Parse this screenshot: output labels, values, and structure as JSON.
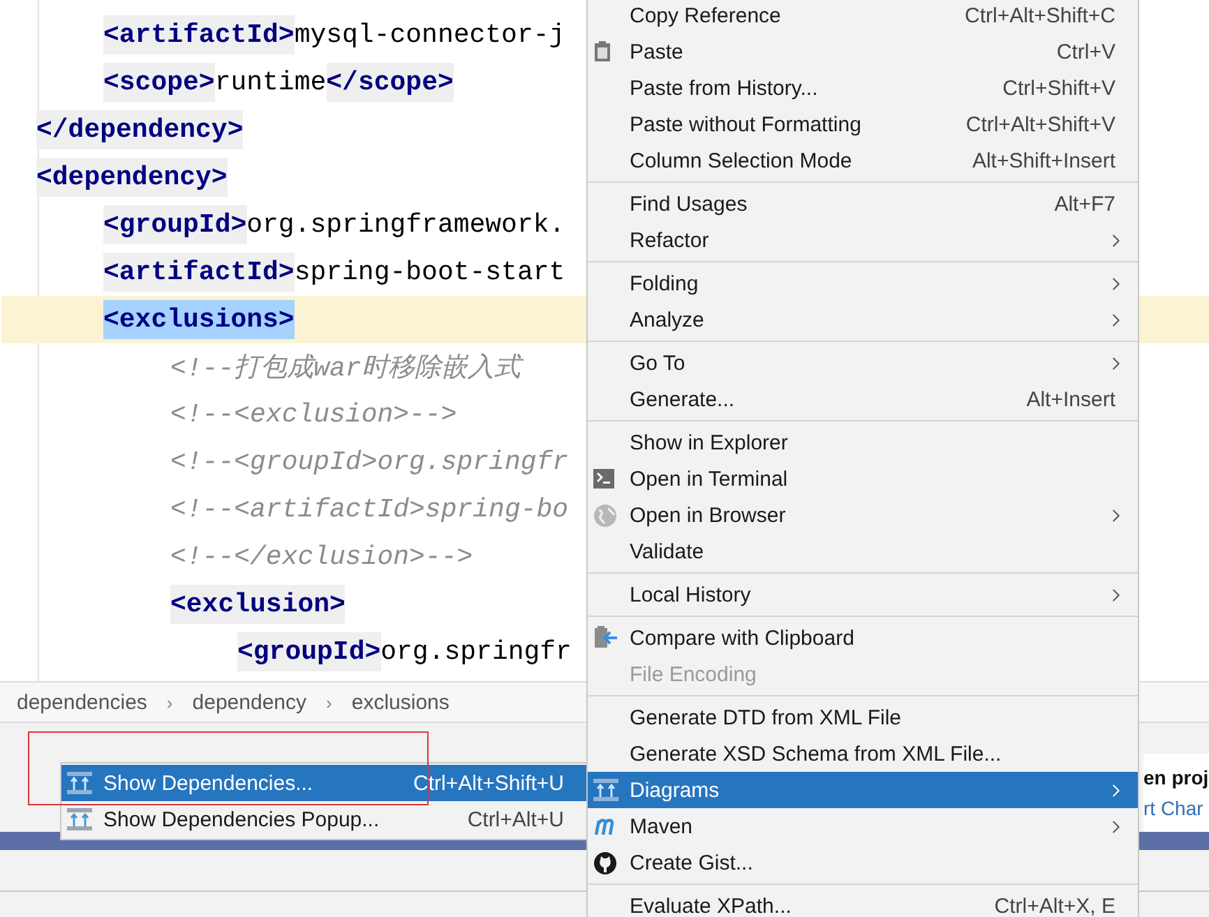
{
  "editor": {
    "lines": [
      {
        "children": [
          {
            "current": false,
            "segments": [
              {
                "kind": "tag",
                "text": "<artifactId>"
              },
              {
                "kind": "text",
                "text": "mysql-connector-j"
              }
            ]
          },
          {
            "current": false,
            "segments": [
              {
                "kind": "tag",
                "text": "<scope>"
              },
              {
                "kind": "text",
                "text": "runtime"
              },
              {
                "kind": "tag",
                "text": "</scope>"
              }
            ]
          }
        ]
      },
      {
        "current": false,
        "segments": [
          {
            "kind": "tag",
            "text": "</dependency>"
          }
        ]
      },
      {
        "current": false,
        "segments": [
          {
            "kind": "tag",
            "text": "<dependency>"
          }
        ],
        "children": [
          {
            "current": false,
            "segments": [
              {
                "kind": "tag",
                "text": "<groupId>"
              },
              {
                "kind": "text",
                "text": "org.springframework."
              }
            ]
          },
          {
            "current": false,
            "segments": [
              {
                "kind": "tag",
                "text": "<artifactId>"
              },
              {
                "kind": "text",
                "text": "spring-boot-start"
              }
            ]
          },
          {
            "current": true,
            "segments": [
              {
                "kind": "selected-tag",
                "text": "<exclusions>"
              }
            ],
            "children": [
              {
                "current": false,
                "segments": [
                  {
                    "kind": "comment",
                    "text": "<!--打包成war时移除嵌入式"
                  }
                ]
              },
              {
                "current": false,
                "segments": [
                  {
                    "kind": "comment",
                    "text": "<!--<exclusion>-->"
                  }
                ]
              },
              {
                "current": false,
                "segments": [
                  {
                    "kind": "comment",
                    "text": "<!--<groupId>org.springfr"
                  }
                ]
              },
              {
                "current": false,
                "segments": [
                  {
                    "kind": "comment",
                    "text": "<!--<artifactId>spring-bo"
                  }
                ]
              },
              {
                "current": false,
                "segments": [
                  {
                    "kind": "comment",
                    "text": "<!--</exclusion>-->"
                  }
                ]
              },
              {
                "current": false,
                "segments": [
                  {
                    "kind": "tag",
                    "text": "<exclusion>"
                  }
                ],
                "children": [
                  {
                    "current": false,
                    "segments": [
                      {
                        "kind": "tag",
                        "text": "<groupId>"
                      },
                      {
                        "kind": "text",
                        "text": "org.springfr"
                      }
                    ]
                  }
                ]
              }
            ]
          }
        ]
      }
    ]
  },
  "breadcrumb": [
    {
      "label": "dependencies",
      "separator": "›"
    },
    {
      "label": "dependency",
      "separator": "›"
    },
    {
      "label": "exclusions"
    }
  ],
  "side_panel": {
    "title": "en proj",
    "link": "rt Char"
  },
  "context_menu": {
    "groups": [
      [
        {
          "label": "Copy Reference",
          "shortcut": "Ctrl+Alt+Shift+C",
          "kind": "plain",
          "submenu": false,
          "disabled": false,
          "selected": false
        },
        {
          "label": "Paste",
          "shortcut": "Ctrl+V",
          "kind": "clipboard",
          "submenu": false,
          "disabled": false,
          "selected": false
        },
        {
          "label": "Paste from History...",
          "shortcut": "Ctrl+Shift+V",
          "kind": "plain",
          "submenu": false,
          "disabled": false,
          "selected": false
        },
        {
          "label": "Paste without Formatting",
          "shortcut": "Ctrl+Alt+Shift+V",
          "kind": "plain",
          "submenu": false,
          "disabled": false,
          "selected": false
        },
        {
          "label": "Column Selection Mode",
          "shortcut": "Alt+Shift+Insert",
          "kind": "plain",
          "submenu": false,
          "disabled": false,
          "selected": false
        }
      ],
      [
        {
          "label": "Find Usages",
          "shortcut": "Alt+F7",
          "kind": "plain",
          "submenu": false,
          "disabled": false,
          "selected": false
        },
        {
          "label": "Refactor",
          "kind": "plain",
          "submenu": true,
          "disabled": false,
          "selected": false
        }
      ],
      [
        {
          "label": "Folding",
          "kind": "plain",
          "submenu": true,
          "disabled": false,
          "selected": false
        },
        {
          "label": "Analyze",
          "kind": "plain",
          "submenu": true,
          "disabled": false,
          "selected": false
        }
      ],
      [
        {
          "label": "Go To",
          "kind": "plain",
          "submenu": true,
          "disabled": false,
          "selected": false
        },
        {
          "label": "Generate...",
          "shortcut": "Alt+Insert",
          "kind": "plain",
          "submenu": false,
          "disabled": false,
          "selected": false
        }
      ],
      [
        {
          "label": "Show in Explorer",
          "kind": "plain",
          "submenu": false,
          "disabled": false,
          "selected": false
        },
        {
          "label": "Open in Terminal",
          "kind": "terminal",
          "submenu": false,
          "disabled": false,
          "selected": false
        },
        {
          "label": "Open in Browser",
          "kind": "globe",
          "submenu": true,
          "disabled": false,
          "selected": false
        },
        {
          "label": "Validate",
          "kind": "plain",
          "submenu": false,
          "disabled": false,
          "selected": false
        }
      ],
      [
        {
          "label": "Local History",
          "kind": "plain",
          "submenu": true,
          "disabled": false,
          "selected": false
        }
      ],
      [
        {
          "label": "Compare with Clipboard",
          "kind": "compare",
          "submenu": false,
          "disabled": false,
          "selected": false
        },
        {
          "label": "File Encoding",
          "kind": "plain",
          "submenu": false,
          "disabled": true,
          "selected": false
        }
      ],
      [
        {
          "label": "Generate DTD from XML File",
          "kind": "plain",
          "submenu": false,
          "disabled": false,
          "selected": false
        },
        {
          "label": "Generate XSD Schema from XML File...",
          "kind": "plain",
          "submenu": false,
          "disabled": false,
          "selected": false
        },
        {
          "label": "Diagrams",
          "kind": "diagram",
          "submenu": true,
          "disabled": false,
          "selected": true
        },
        {
          "label": "Maven",
          "kind": "m-logo",
          "submenu": true,
          "disabled": false,
          "selected": false
        },
        {
          "label": "Create Gist...",
          "kind": "round-logo",
          "submenu": false,
          "disabled": false,
          "selected": false
        }
      ],
      [
        {
          "label": "Evaluate XPath...",
          "shortcut": "Ctrl+Alt+X, E",
          "kind": "plain",
          "submenu": false,
          "disabled": false,
          "selected": false
        }
      ]
    ]
  },
  "submenu": {
    "items": [
      {
        "label": "Show Dependencies...",
        "shortcut": "Ctrl+Alt+Shift+U",
        "kind": "diagram",
        "selected": true
      },
      {
        "label": "Show Dependencies Popup...",
        "shortcut": "Ctrl+Alt+U",
        "kind": "diagram",
        "selected": false
      }
    ]
  }
}
